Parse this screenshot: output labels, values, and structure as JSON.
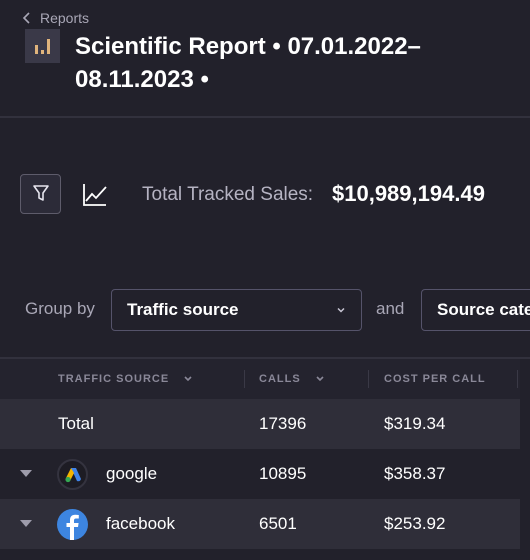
{
  "nav": {
    "back_label": "Reports"
  },
  "header": {
    "title": "Scientific Report • 07.01.2022–08.11.2023 •"
  },
  "summary": {
    "total_label": "Total Tracked Sales:",
    "total_value": "$10,989,194.49"
  },
  "grouping": {
    "group_by_label": "Group by",
    "primary_value": "Traffic source",
    "and_label": "and",
    "secondary_value": "Source category"
  },
  "table": {
    "columns": [
      "TRAFFIC SOURCE",
      "CALLS",
      "COST PER CALL"
    ],
    "total_row": {
      "label": "Total",
      "calls": "17396",
      "cost_per_call": "$319.34"
    },
    "rows": [
      {
        "source": "google",
        "icon": "google-ads-icon",
        "calls": "10895",
        "cost_per_call": "$358.37"
      },
      {
        "source": "facebook",
        "icon": "facebook-icon",
        "calls": "6501",
        "cost_per_call": "$253.92"
      }
    ]
  },
  "colors": {
    "background": "#22212b",
    "row_alt": "#2f2e39",
    "accent_bars": "#e0b47c",
    "facebook_blue": "#3d85e0"
  }
}
